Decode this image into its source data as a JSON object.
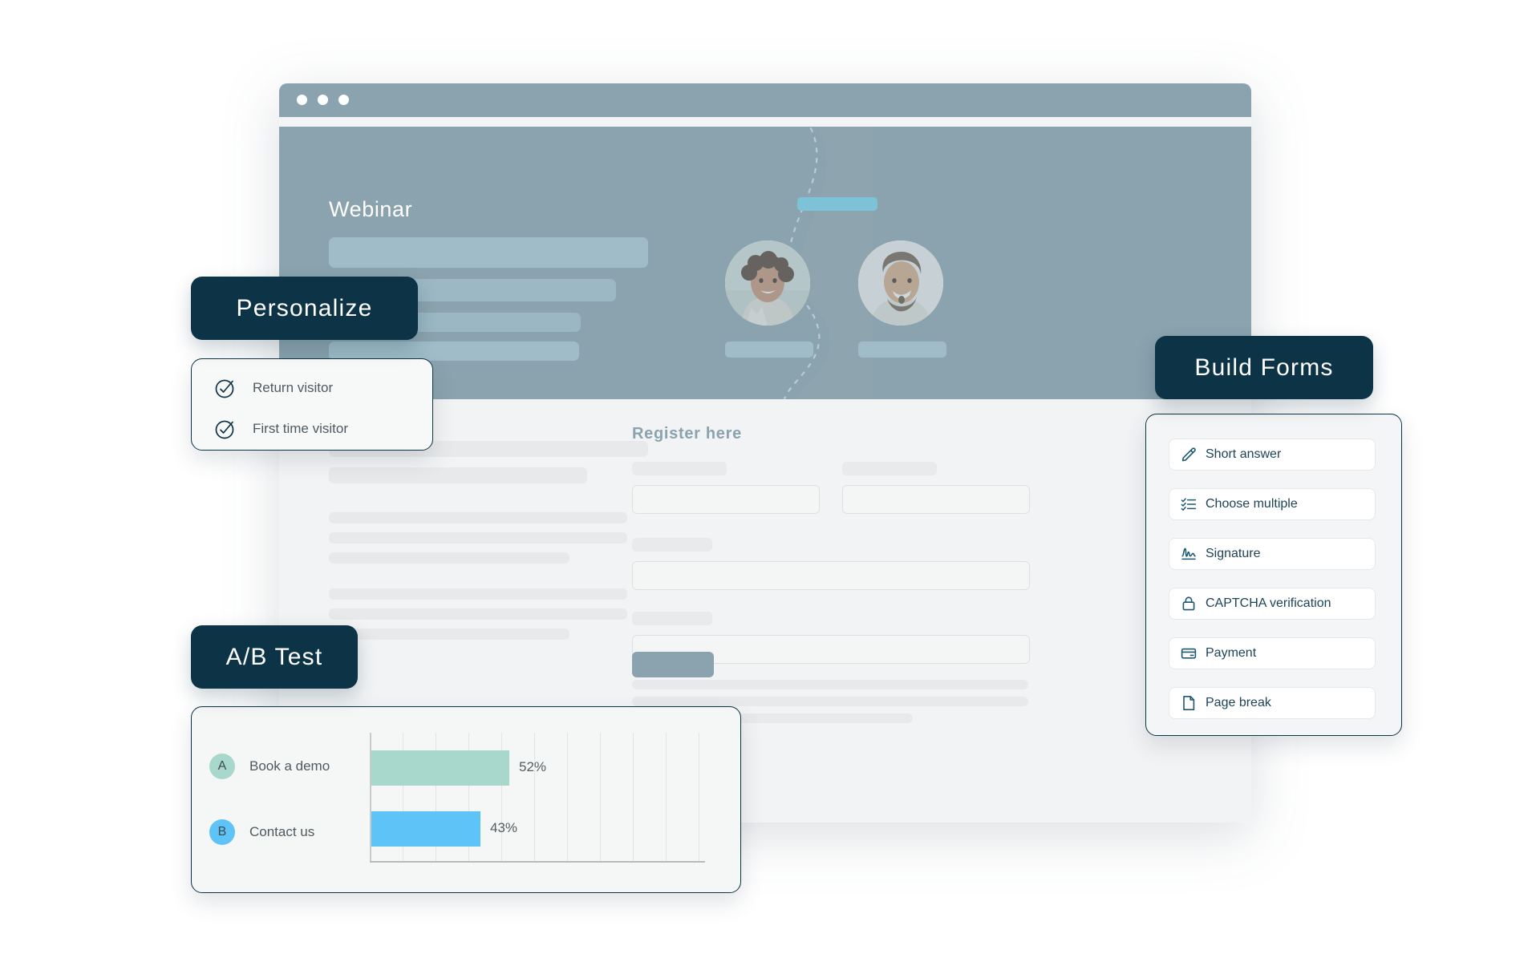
{
  "browser": {
    "window_dots": [
      "dot-1",
      "dot-2",
      "dot-3"
    ]
  },
  "hero": {
    "title": "Webinar",
    "avatars": [
      {
        "name": "avatar-woman-smiling"
      },
      {
        "name": "avatar-man-smiling"
      }
    ]
  },
  "page": {
    "register_title": "Register here"
  },
  "pills": {
    "personalize": "Personalize",
    "build_forms": "Build Forms",
    "ab_test": "A/B Test"
  },
  "personalize_card": {
    "options": [
      {
        "label": "Return visitor",
        "icon": "check-circle-icon"
      },
      {
        "label": "First time visitor",
        "icon": "check-circle-icon"
      }
    ]
  },
  "build_forms_card": {
    "items": [
      {
        "label": "Short answer",
        "icon": "pencil-icon"
      },
      {
        "label": "Choose multiple",
        "icon": "checklist-icon"
      },
      {
        "label": "Signature",
        "icon": "signature-icon"
      },
      {
        "label": "CAPTCHA verification",
        "icon": "lock-icon"
      },
      {
        "label": "Payment",
        "icon": "credit-card-icon"
      },
      {
        "label": "Page break",
        "icon": "document-icon"
      }
    ]
  },
  "colors": {
    "ink": "#0d3446",
    "slate": "#8ba3ae",
    "variant_a": "#a8d8cb",
    "variant_b": "#5ec3f7",
    "page_bg": "#f2f3f4"
  },
  "chart_data": {
    "type": "bar",
    "title": "A/B Test",
    "orientation": "horizontal",
    "categories": [
      "Book a demo",
      "Contact us"
    ],
    "values": [
      52,
      43
    ],
    "value_labels": [
      "52%",
      "43%"
    ],
    "badges": [
      "A",
      "B"
    ],
    "series": [
      {
        "name": "Book a demo",
        "badge": "A",
        "value": 52,
        "label": "52%",
        "color": "#a8d8cb"
      },
      {
        "name": "Contact us",
        "badge": "B",
        "value": 43,
        "label": "43%",
        "color": "#5ec3f7"
      }
    ],
    "xlabel": "",
    "ylabel": "",
    "xlim": [
      0,
      124
    ],
    "gridlines": 10,
    "grid": true,
    "legend": "none"
  }
}
